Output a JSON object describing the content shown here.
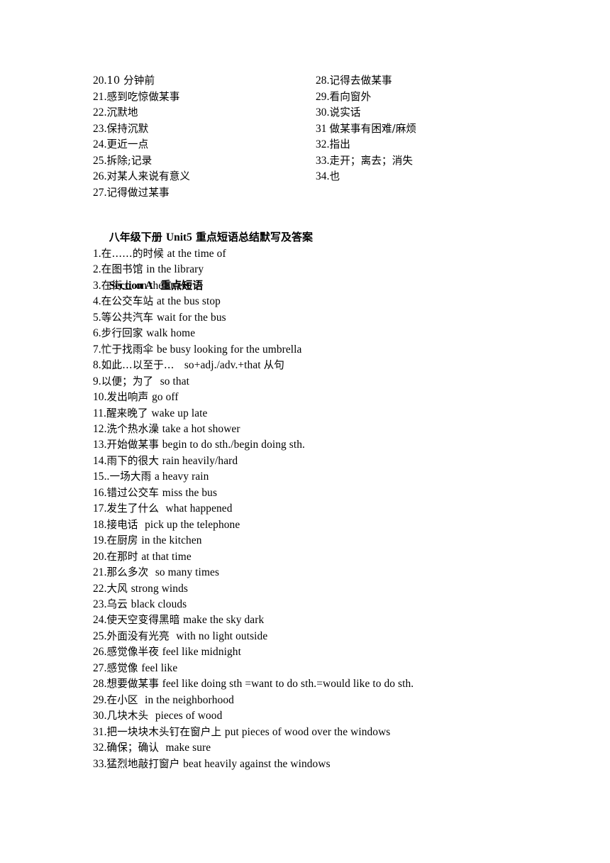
{
  "document": {
    "page_background": "#ffffff",
    "text_color": "#000000"
  },
  "top_section": {
    "left_column": [
      {
        "num": "20.",
        "cjk": "10 分钟前",
        "en": ""
      },
      {
        "num": "21.",
        "cjk": "感到吃惊做某事",
        "en": ""
      },
      {
        "num": "22.",
        "cjk": "沉默地",
        "en": ""
      },
      {
        "num": "23.",
        "cjk": "保持沉默",
        "en": ""
      },
      {
        "num": "24.",
        "cjk": "更近一点",
        "en": ""
      },
      {
        "num": "25.",
        "cjk": "拆除;记录",
        "en": ""
      },
      {
        "num": "26.",
        "cjk": "对某人来说有意义",
        "en": ""
      },
      {
        "num": "27.",
        "cjk": "记得做过某事",
        "en": ""
      }
    ],
    "right_column": [
      {
        "num": "28.",
        "cjk": "记得去做某事",
        "en": ""
      },
      {
        "num": "29.",
        "cjk": "看向窗外",
        "en": ""
      },
      {
        "num": "30.",
        "cjk": "说实话",
        "en": ""
      },
      {
        "num": "31 ",
        "cjk": "做某事有困难/麻烦",
        "en": ""
      },
      {
        "num": "32.",
        "cjk": "指出",
        "en": ""
      },
      {
        "num": "33.",
        "cjk": "走开；离去；消失",
        "en": ""
      },
      {
        "num": "34.",
        "cjk": "也",
        "en": ""
      }
    ]
  },
  "headings": {
    "title_cjk_1": "八年级下册 ",
    "title_en_1": "Unit5",
    "title_cjk_2": " 重点短语总结默写及答案",
    "subtitle_en": "Section A",
    "subtitle_cjk": "  重点短语"
  },
  "main_list": [
    {
      "num": "1.",
      "cjk": "在……的时候 ",
      "en": "at the time of"
    },
    {
      "num": "2.",
      "cjk": "在图书馆 ",
      "en": "in the library"
    },
    {
      "num": "3.",
      "cjk": "在街上 ",
      "en": "on the street"
    },
    {
      "num": "4.",
      "cjk": "在公交车站 ",
      "en": "at the bus stop"
    },
    {
      "num": "5.",
      "cjk": "等公共汽车 ",
      "en": "wait for the bus"
    },
    {
      "num": "6.",
      "cjk": "步行回家 ",
      "en": "walk home"
    },
    {
      "num": "7.",
      "cjk": "忙于找雨伞 ",
      "en": "be busy looking for the umbrella"
    },
    {
      "num": "8.",
      "cjk": "如此…以至于…   ",
      "en": "so+adj./adv.+that ",
      "cjk_tail": "从句"
    },
    {
      "num": "9.",
      "cjk": "以便；为了  ",
      "en": "so that"
    },
    {
      "num": "10.",
      "cjk": "发出响声 ",
      "en": "go off"
    },
    {
      "num": "11.",
      "cjk": "醒来晚了 ",
      "en": "wake up late"
    },
    {
      "num": "12.",
      "cjk": "洗个热水澡 ",
      "en": "take a hot shower"
    },
    {
      "num": "13.",
      "cjk": "开始做某事 ",
      "en": "begin to do sth./begin doing sth."
    },
    {
      "num": "14.",
      "cjk": "雨下的很大 ",
      "en": "rain heavily/hard"
    },
    {
      "num": "15..",
      "cjk": "一场大雨 ",
      "en": "a heavy rain"
    },
    {
      "num": "16.",
      "cjk": "错过公交车 ",
      "en": "miss the bus"
    },
    {
      "num": "17.",
      "cjk": "发生了什么  ",
      "en": "what happened"
    },
    {
      "num": "18.",
      "cjk": "接电话  ",
      "en": "pick up the telephone"
    },
    {
      "num": "19.",
      "cjk": "在厨房 ",
      "en": "in the kitchen"
    },
    {
      "num": "20.",
      "cjk": "在那时 ",
      "en": "at that time"
    },
    {
      "num": "21.",
      "cjk": "那么多次  ",
      "en": "so many times"
    },
    {
      "num": "22.",
      "cjk": "大风 ",
      "en": "strong winds"
    },
    {
      "num": "23.",
      "cjk": "乌云 ",
      "en": "black clouds"
    },
    {
      "num": "24.",
      "cjk": "使天空变得黑暗 ",
      "en": "make the sky dark"
    },
    {
      "num": "25.",
      "cjk": "外面没有光亮  ",
      "en": "with no light outside"
    },
    {
      "num": "26.",
      "cjk": "感觉像半夜 ",
      "en": "feel like midnight"
    },
    {
      "num": "27.",
      "cjk": "感觉像 ",
      "en": "feel like"
    },
    {
      "num": "28.",
      "cjk": "想要做某事 ",
      "en": "feel like doing sth =want to do sth.=would like to do sth."
    },
    {
      "num": "29.",
      "cjk": "在小区  ",
      "en": "in the neighborhood"
    },
    {
      "num": "30.",
      "cjk": "几块木头  ",
      "en": "pieces of wood"
    },
    {
      "num": "31.",
      "cjk": "把一块块木头钉在窗户上 ",
      "en": "put pieces of wood over the windows"
    },
    {
      "num": "32.",
      "cjk": "确保；确认  ",
      "en": "make sure"
    },
    {
      "num": "33.",
      "cjk": "猛烈地敲打窗户 ",
      "en": "beat heavily against the windows"
    }
  ]
}
